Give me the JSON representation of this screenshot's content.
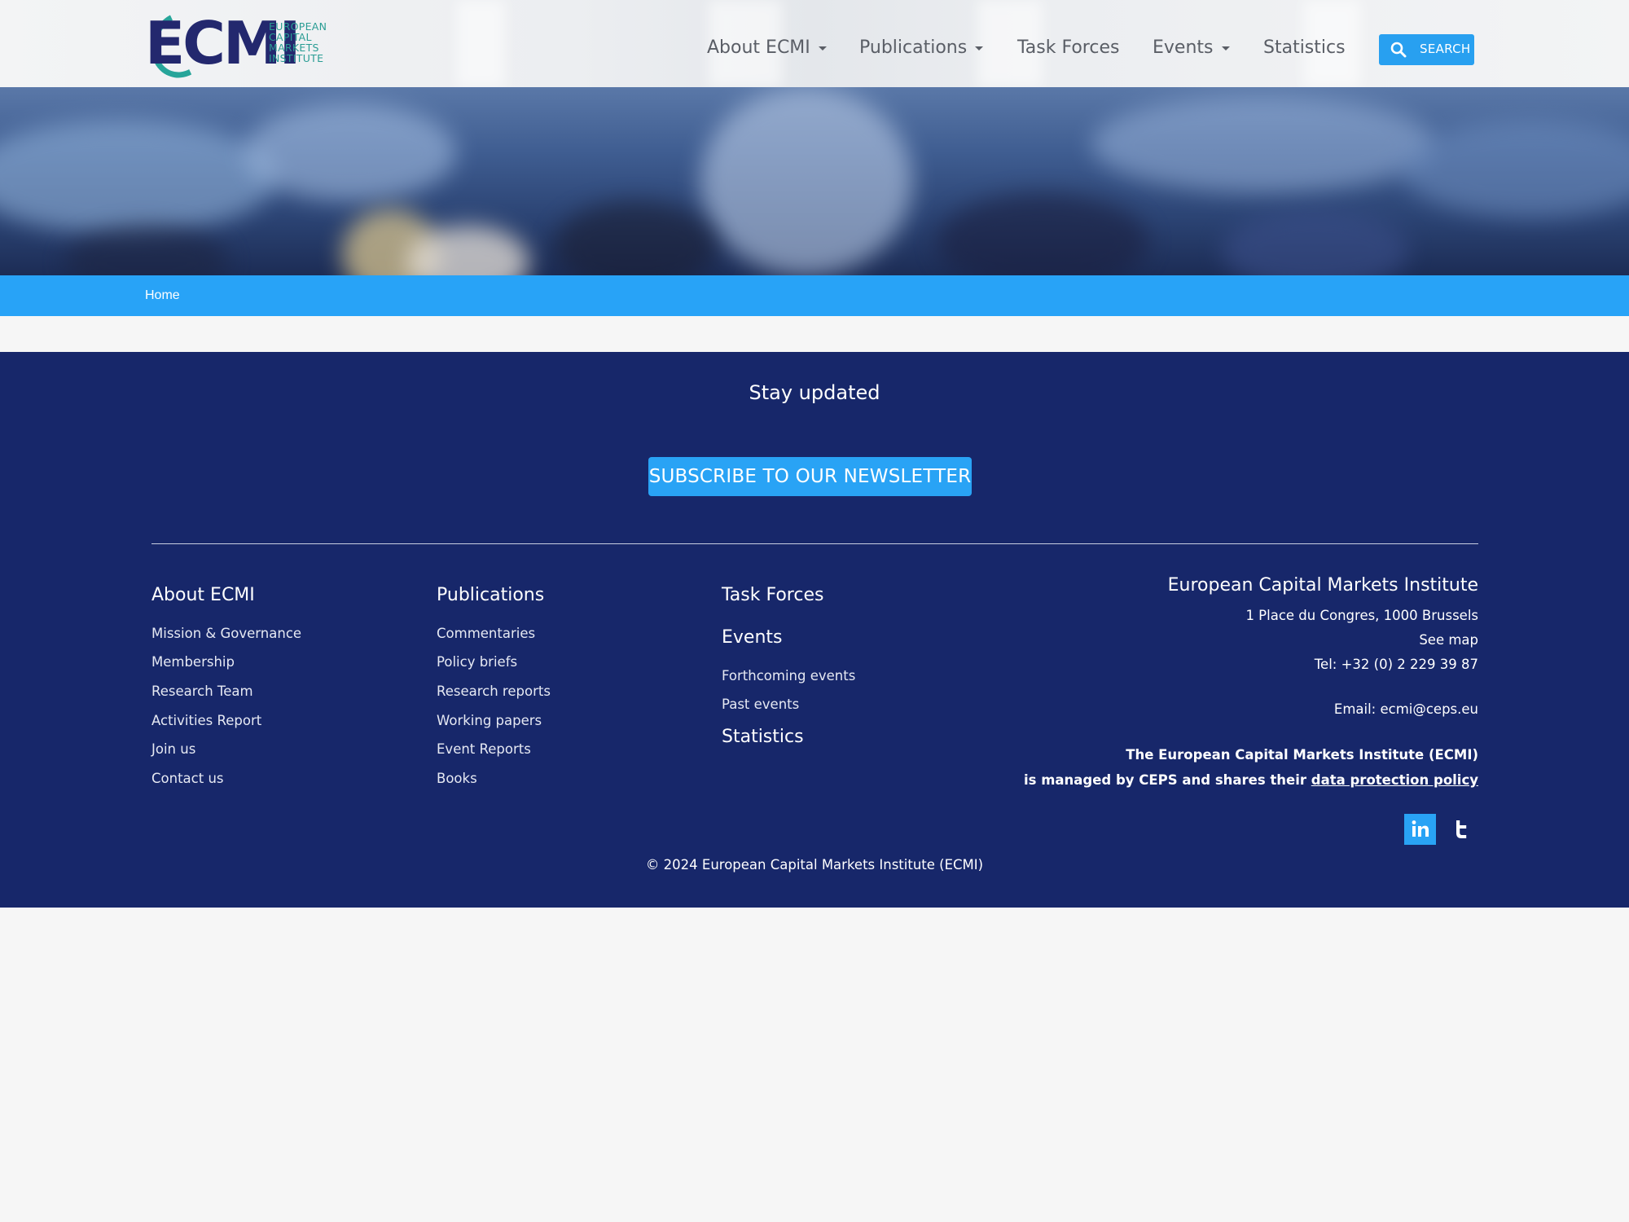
{
  "header": {
    "logo": {
      "wordmark": "ECMI",
      "subtitle_lines": [
        "EUROPEAN",
        "CAPITAL",
        "MARKETS",
        "INSTITUTE"
      ]
    },
    "nav": [
      {
        "label": "About ECMI",
        "has_dropdown": true
      },
      {
        "label": "Publications",
        "has_dropdown": true
      },
      {
        "label": "Task Forces",
        "has_dropdown": false
      },
      {
        "label": "Events",
        "has_dropdown": true
      },
      {
        "label": "Statistics",
        "has_dropdown": false
      }
    ],
    "search": {
      "label": "SEARCH",
      "icon": "search-icon"
    }
  },
  "breadcrumb": {
    "home": "Home"
  },
  "footer": {
    "stay_updated": "Stay updated",
    "subscribe_label": "SUBSCRIBE TO OUR NEWSLETTER",
    "about": {
      "title": "About ECMI",
      "links": [
        "Mission & Governance",
        "Membership",
        "Research Team",
        "Activities Report",
        "Join us",
        "Contact us"
      ]
    },
    "publications": {
      "title": "Publications",
      "links": [
        "Commentaries",
        "Policy briefs",
        "Research reports",
        "Working papers",
        "Event Reports",
        "Books"
      ]
    },
    "task_forces": {
      "title": "Task Forces"
    },
    "events": {
      "title": "Events",
      "links": [
        "Forthcoming events",
        "Past events"
      ]
    },
    "statistics": {
      "title": "Statistics"
    },
    "contact": {
      "name": "European Capital Markets Institute",
      "address": "1 Place du Congres, 1000 Brussels",
      "map": "See map",
      "tel": "Tel: +32 (0) 2 229 39 87",
      "email": "Email: ecmi@ceps.eu",
      "managed_line1": "The European Capital Markets Institute (ECMI)",
      "managed_line2_prefix": "is managed by CEPS and shares their ",
      "managed_link": "data protection policy"
    },
    "social": [
      "linkedin-icon",
      "twitter-icon"
    ],
    "copyright": "© 2024 European Capital Markets Institute (ECMI)"
  },
  "colors": {
    "accent_blue": "#28a3f7",
    "footer_navy": "#17276a",
    "logo_navy": "#23286e",
    "logo_teal": "#27a59a",
    "page_bg": "#f6f6f6"
  }
}
